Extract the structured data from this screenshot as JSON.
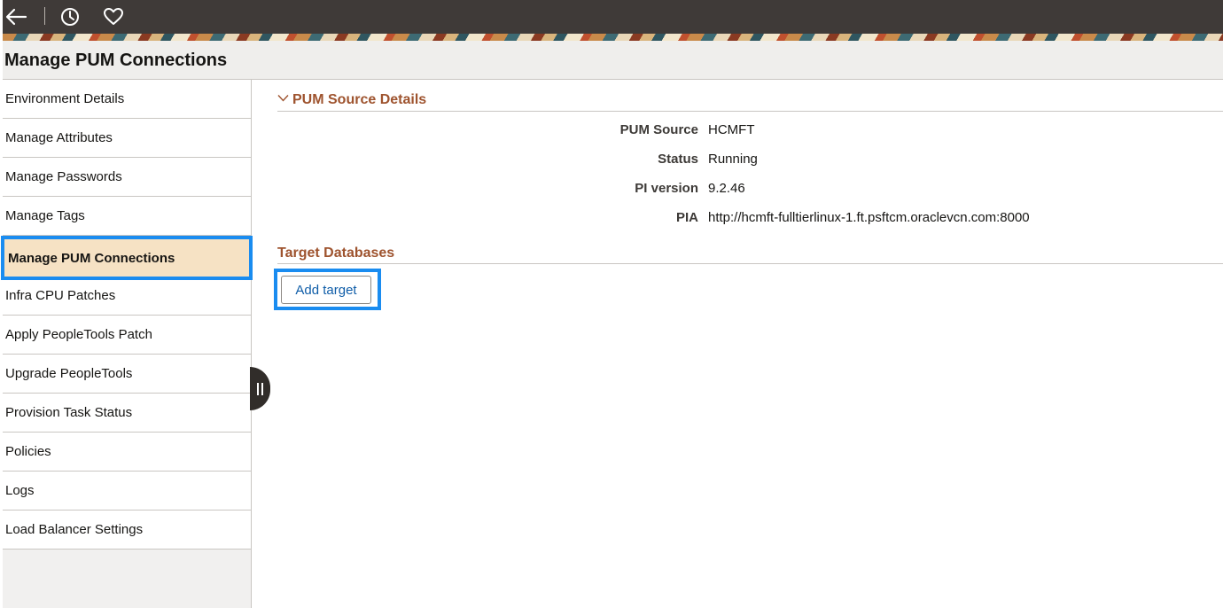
{
  "toolbar": {
    "back_icon": "back-arrow-icon",
    "recent_icon": "clock-icon",
    "favorites_icon": "heart-icon"
  },
  "page": {
    "title": "Manage PUM Connections"
  },
  "sidebar": {
    "items": [
      {
        "label": "Environment Details"
      },
      {
        "label": "Manage Attributes"
      },
      {
        "label": "Manage Passwords"
      },
      {
        "label": "Manage Tags"
      },
      {
        "label": "Manage PUM Connections",
        "active": true
      },
      {
        "label": "Infra CPU Patches"
      },
      {
        "label": "Apply PeopleTools Patch"
      },
      {
        "label": "Upgrade PeopleTools"
      },
      {
        "label": "Provision Task Status"
      },
      {
        "label": "Policies"
      },
      {
        "label": "Logs"
      },
      {
        "label": "Load Balancer Settings"
      }
    ]
  },
  "pum_source": {
    "heading": "PUM Source Details",
    "fields": [
      {
        "label": "PUM Source",
        "value": "HCMFT"
      },
      {
        "label": "Status",
        "value": "Running"
      },
      {
        "label": "PI version",
        "value": "9.2.46"
      },
      {
        "label": "PIA",
        "value": "http://hcmft-fulltierlinux-1.ft.psftcm.oraclevcn.com:8000"
      }
    ]
  },
  "target_databases": {
    "heading": "Target Databases",
    "add_button_label": "Add target"
  },
  "colors": {
    "accent_highlight": "#1a8cf0",
    "section_heading": "#9e532e",
    "active_item_bg": "#f6e2c4",
    "topbar_bg": "#3f3a38",
    "link_blue": "#0f5da8"
  }
}
